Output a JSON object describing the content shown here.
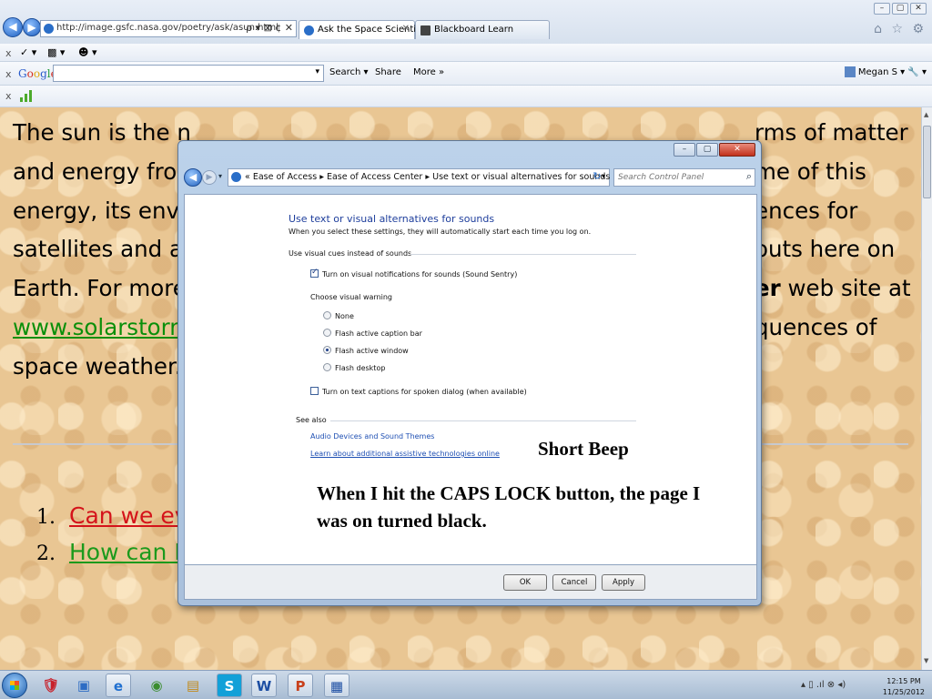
{
  "browser": {
    "address_url": "http://image.gsfc.nasa.gov/poetry/ask/asun.html",
    "address_actions": "ρ ▾ ⊠ ¢ ✕",
    "tabs": [
      {
        "title": "Ask the Space Scientist abo...",
        "close": "✕"
      },
      {
        "title": "Blackboard Learn",
        "close": ""
      }
    ],
    "window_controls": [
      "–",
      "▢",
      "✕"
    ],
    "right_icons": "⌂ ☆ ⚙",
    "toolbar1": {
      "close": "x",
      "items": [
        "✓ ▾",
        "▩ ▾",
        "☻ ▾"
      ]
    },
    "google_bar": {
      "close": "x",
      "logo": [
        "G",
        "o",
        "o",
        "g",
        "l",
        "e"
      ],
      "search_dropdown": "▾",
      "search_btn": "Search ▾",
      "share_btn": "Share",
      "more_btn": "More »",
      "user": "Megan S ▾",
      "wrench": "🔧 ▾"
    },
    "toolbar3": {
      "close": "x"
    }
  },
  "page": {
    "lines": [
      {
        "left": "The sun is the n",
        "right": "rms of matter"
      },
      {
        "left": "and energy from",
        "right": "me of this"
      },
      {
        "left": "energy, its envir",
        "right": "ences for"
      },
      {
        "left": "satellites and as",
        "right": "outs here on"
      },
      {
        "left": "Earth. For more",
        "right_bold": "er",
        "right": " web site at"
      },
      {
        "link": "www.solarstorm.",
        "right": "quences of"
      },
      {
        "left": "space weather.",
        "right": ""
      }
    ],
    "questions": [
      {
        "num": "1.",
        "text": "Can we ever alter the spectrum of the sun?"
      },
      {
        "num": "2.",
        "text": "How can I pick up solar activity on my short wave radio?"
      }
    ],
    "scroll_up": "▲",
    "scroll_down": "▼"
  },
  "dialog": {
    "controls": [
      "–",
      "▢",
      "✕"
    ],
    "back": "◀",
    "forward": "▶",
    "history": "▾",
    "breadcrumb": "« Ease of Access ▸ Ease of Access Center ▸ Use text or visual alternatives for sounds",
    "breadcrumb_dd": "▾",
    "refresh": "↻",
    "search_placeholder": "Search Control Panel",
    "search_icon": "⌕",
    "heading": "Use text or visual alternatives for sounds",
    "subheading": "When you select these settings, they will automatically start each time you log on.",
    "section_visual": "Use visual cues instead of sounds",
    "sound_sentry": "Turn on visual notifications for sounds (Sound Sentry)",
    "choose_warning": "Choose visual warning",
    "warnings": [
      "None",
      "Flash active caption bar",
      "Flash active window",
      "Flash desktop"
    ],
    "captions": "Turn on text captions for spoken dialog (when available)",
    "see_also": "See also",
    "link_audio": "Audio Devices and Sound Themes",
    "link_assistive": "Learn about additional assistive technologies online",
    "ok": "OK",
    "cancel": "Cancel",
    "apply": "Apply"
  },
  "annotations": {
    "short_beep": "Short Beep",
    "caps_note": "When I hit the CAPS LOCK button, the page I was on turned black."
  },
  "taskbar": {
    "apps": [
      "🛡",
      "▣",
      "e",
      "◉",
      "▤",
      "S",
      "W",
      "P",
      "▦"
    ],
    "tray_icons": "▴ ▯ .ıl ⊗ ◂)",
    "time": "12:15 PM",
    "date": "11/25/2012"
  }
}
